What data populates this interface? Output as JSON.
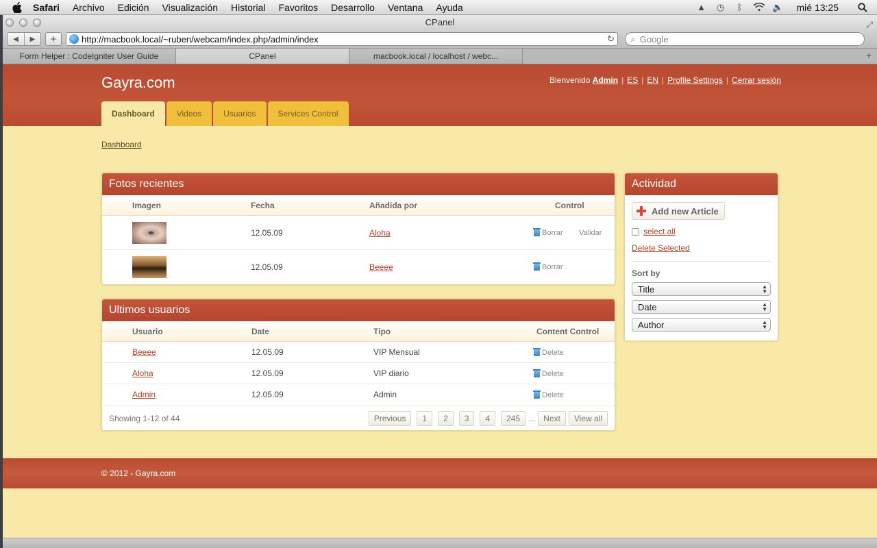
{
  "menubar": {
    "app": "Safari",
    "items": [
      "Archivo",
      "Edición",
      "Visualización",
      "Historial",
      "Favoritos",
      "Desarrollo",
      "Ventana",
      "Ayuda"
    ],
    "clock": "mié 13:25"
  },
  "window": {
    "title": "CPanel"
  },
  "toolbar": {
    "url": "http://macbook.local/~ruben/webcam/index.php/admin/index",
    "search_placeholder": "Google"
  },
  "browser_tabs": [
    "Form Helper : CodeIgniter User Guide",
    "CPanel",
    "macbook.local / localhost / webc..."
  ],
  "site": {
    "brand": "Gayra.com",
    "welcome": "Bienvenido",
    "user": "Admin",
    "links": [
      "ES",
      "EN",
      "Profile Settings",
      "Cerrar sesión"
    ],
    "nav": [
      "Dashboard",
      "Videos",
      "Usuarios",
      "Services Control"
    ],
    "breadcrumb": "Dashboard"
  },
  "fotos": {
    "title": "Fotos recientes",
    "headers": [
      "Imagen",
      "Fecha",
      "Añadida por",
      "Control"
    ],
    "rows": [
      {
        "date": "12.05.09",
        "by": "Aloha",
        "borrar": "Borrar",
        "validar": "Validar"
      },
      {
        "date": "12.05.09",
        "by": "Beeee",
        "borrar": "Borrar"
      }
    ]
  },
  "usuarios": {
    "title": "Ultimos usuarios",
    "headers": [
      "Usuario",
      "Date",
      "Tipo",
      "Content Control"
    ],
    "rows": [
      {
        "user": "Beeee",
        "date": "12.05.09",
        "type": "VIP Mensual",
        "action": "Delete"
      },
      {
        "user": "Aloha",
        "date": "12.05.09",
        "type": "VIP diario",
        "action": "Delete"
      },
      {
        "user": "Admin",
        "date": "12.05.09",
        "type": "Admin",
        "action": "Delete"
      }
    ],
    "showing": "Showing 1-12 of 44",
    "pager": {
      "previous": "Previous",
      "pages": [
        "1",
        "2",
        "3",
        "4",
        "245"
      ],
      "ellipsis": "...",
      "next": "Next",
      "view_all": "View all"
    }
  },
  "actividad": {
    "title": "Actividad",
    "add_button": "Add new Article",
    "select_all": "select all",
    "delete_selected": "Delete Selected",
    "sort_by": "Sort by",
    "sort_options": [
      "Title",
      "Date",
      "Author"
    ]
  },
  "footer": {
    "text": "© 2012 - Gayra.com"
  }
}
